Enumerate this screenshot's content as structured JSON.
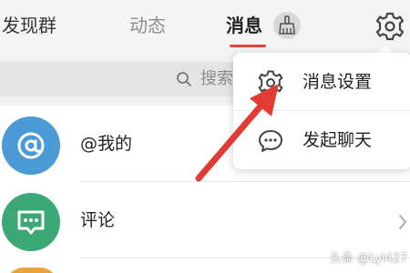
{
  "header": {
    "tabs": [
      {
        "label": "发现群"
      },
      {
        "label": "动态"
      },
      {
        "label": "消息"
      }
    ]
  },
  "search": {
    "placeholder": "搜索"
  },
  "list": {
    "items": [
      {
        "label": "@我的",
        "icon": "at-icon"
      },
      {
        "label": "评论",
        "icon": "comment-icon"
      }
    ]
  },
  "menu": {
    "items": [
      {
        "label": "消息设置",
        "icon": "gear-icon"
      },
      {
        "label": "发起聊天",
        "icon": "chat-bubble-icon"
      }
    ]
  },
  "watermark": {
    "text": "头条 @Lyl427"
  },
  "colors": {
    "accent": "#e2473a",
    "mention_avatar": "#4a9ad6",
    "comment_avatar": "#3aa774",
    "arrow": "#e23b33"
  }
}
